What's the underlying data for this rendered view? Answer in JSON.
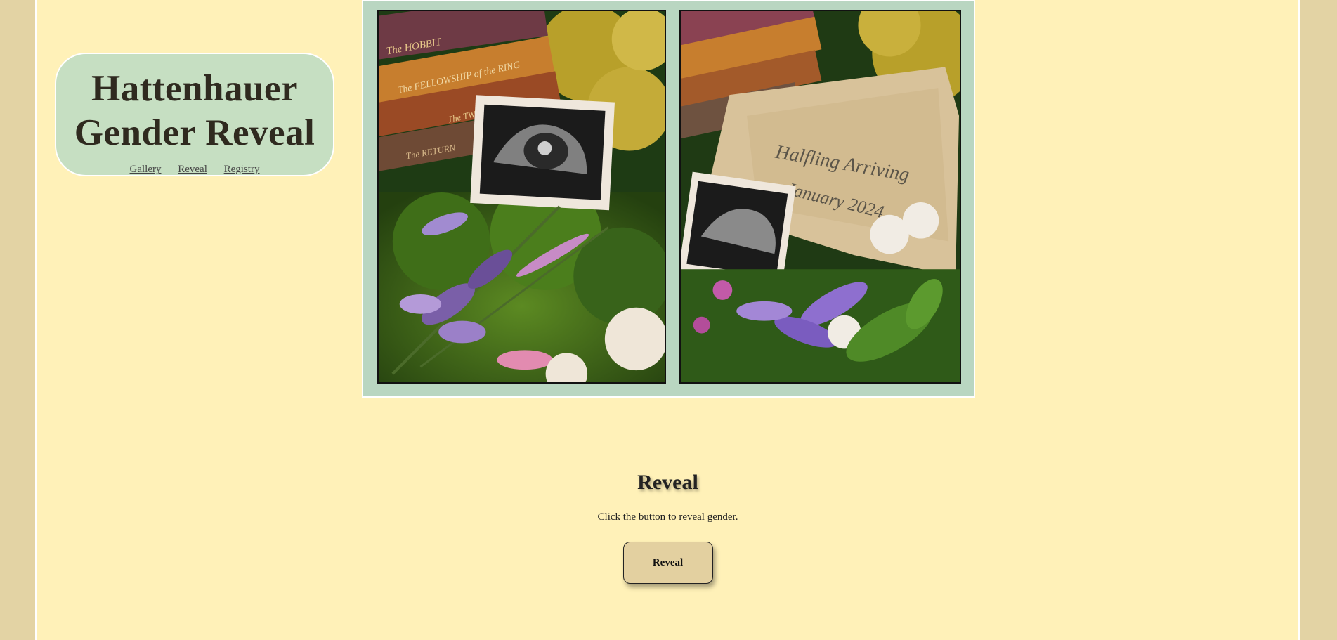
{
  "header": {
    "title_line1": "Hattenhauer",
    "title_line2": "Gender Reveal",
    "nav": [
      "Gallery",
      "Reveal",
      "Registry"
    ]
  },
  "gallery": {
    "left_photo": {
      "books": [
        "The HOBBIT",
        "The FELLOWSHIP of the RING",
        "The TWO TOWERS",
        "The RETURN"
      ]
    },
    "right_photo": {
      "parchment_line1": "Halfling Arriving",
      "parchment_line2": "January 2024"
    }
  },
  "reveal": {
    "heading": "Reveal",
    "instruction": "Click the button to reveal gender.",
    "button_label": "Reveal"
  },
  "colors": {
    "outer_background": "#e3d3a4",
    "page_background": "#fff1b8",
    "header_box": "#c6dfc2",
    "gallery_frame": "#b9d6c1",
    "button": "#e3d0a0"
  }
}
